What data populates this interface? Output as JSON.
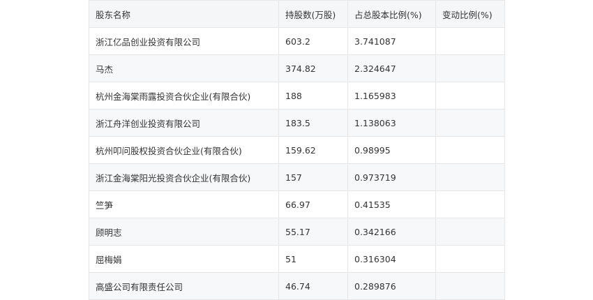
{
  "table": {
    "headers": [
      "股东名称",
      "持股数(万股)",
      "占总股本比例(%)",
      "变动比例(%)"
    ],
    "rows": [
      [
        "浙江亿品创业投资有限公司",
        "603.2",
        "3.741087",
        ""
      ],
      [
        "马杰",
        "374.82",
        "2.324647",
        ""
      ],
      [
        "杭州金海棠雨露投资合伙企业(有限合伙)",
        "188",
        "1.165983",
        ""
      ],
      [
        "浙江舟洋创业投资有限公司",
        "183.5",
        "1.138063",
        ""
      ],
      [
        "杭州叩问股权投资合伙企业(有限合伙)",
        "159.62",
        "0.98995",
        ""
      ],
      [
        "浙江金海棠阳光投资合伙企业(有限合伙)",
        "157",
        "0.973719",
        ""
      ],
      [
        "竺笋",
        "66.97",
        "0.41535",
        ""
      ],
      [
        "顾明志",
        "55.17",
        "0.342166",
        ""
      ],
      [
        "屈梅娟",
        "51",
        "0.316304",
        ""
      ],
      [
        "高盛公司有限责任公司",
        "46.74",
        "0.289876",
        ""
      ]
    ]
  }
}
